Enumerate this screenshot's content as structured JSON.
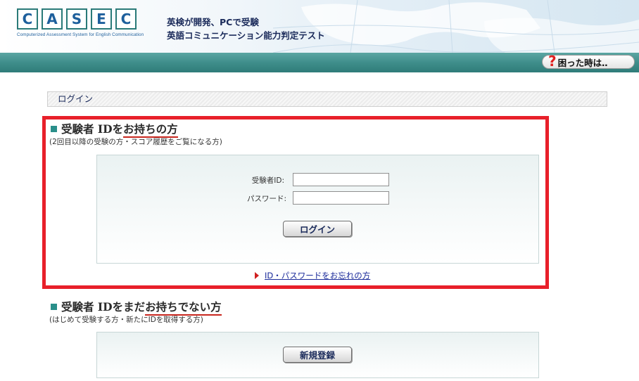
{
  "header": {
    "logo_letters": [
      "C",
      "A",
      "S",
      "E",
      "C"
    ],
    "logo_subtitle": "Computerized Assessment System for English Communication",
    "tagline_line1": "英検が開発、PCで受験",
    "tagline_line2": "英語コミュニケーション能力判定テスト",
    "help_label": "困った時は‥",
    "help_icon": "question-mark-icon"
  },
  "login_section": {
    "title": "ログイン"
  },
  "existing_user": {
    "heading_prefix": "受験者 IDを",
    "heading_emph": "お持ちの方",
    "note": "(2回目以降の受験の方・スコア履歴をご覧になる方)",
    "id_label": "受験者ID:",
    "id_value": "",
    "password_label": "パスワード:",
    "password_value": "",
    "login_button": "ログイン",
    "forgot_link": "ID・パスワードをお忘れの方"
  },
  "new_user": {
    "heading_prefix": "受験者 IDをまだ",
    "heading_emph": "お持ちでない方",
    "note": "(はじめて受験する方・新たにIDを取得する方)",
    "register_button": "新規登録"
  },
  "colors": {
    "teal": "#3f8e8b",
    "highlight_red": "#e8202a",
    "link_blue": "#1a2a9a"
  }
}
